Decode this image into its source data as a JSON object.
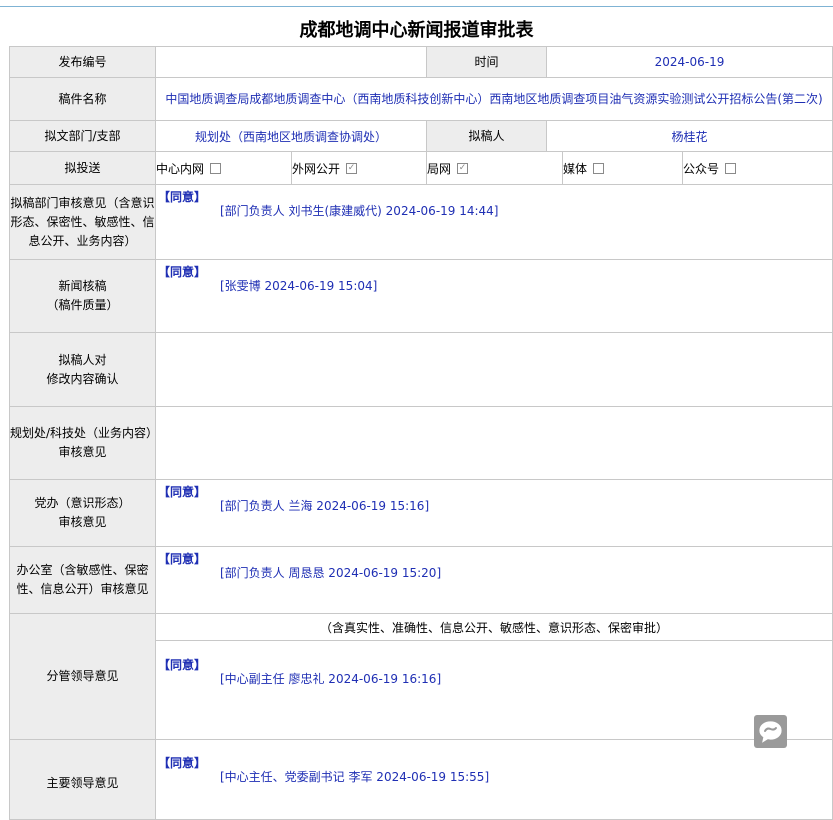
{
  "title": "成都地调中心新闻报道审批表",
  "rows": {
    "publish_no": {
      "label": "发布编号",
      "value": ""
    },
    "time": {
      "label": "时间",
      "value": "2024-06-19"
    },
    "manuscript": {
      "label": "稿件名称",
      "value": "中国地质调查局成都地质调查中心（西南地质科技创新中心）西南地区地质调查项目油气资源实验测试公开招标公告(第二次)"
    },
    "department": {
      "label": "拟文部门/支部",
      "value": "规划处（西南地区地质调查协调处）"
    },
    "author": {
      "label": "拟稿人",
      "value": "杨桂花"
    },
    "send": {
      "label": "拟投送",
      "options": [
        {
          "label": "中心内网",
          "checked": false
        },
        {
          "label": "外网公开",
          "checked": true
        },
        {
          "label": "局网",
          "checked": true
        },
        {
          "label": "媒体",
          "checked": false
        },
        {
          "label": "公众号",
          "checked": false
        }
      ]
    },
    "dept_review": {
      "label": "拟稿部门审核意见（含意识形态、保密性、敏感性、信息公开、业务内容）",
      "agree": "【同意】",
      "sign": "[部门负责人 刘书生(康建威代) 2024-06-19 14:44]"
    },
    "news_review": {
      "label_line1": "新闻核稿",
      "label_line2": "（稿件质量）",
      "agree": "【同意】",
      "sign": "[张雯博 2024-06-19 15:04]"
    },
    "author_confirm": {
      "label_line1": "拟稿人对",
      "label_line2": "修改内容确认"
    },
    "planning_review": {
      "label_line1": "规划处/科技处（业务内容）",
      "label_line2": "审核意见"
    },
    "party_review": {
      "label_line1": "党办（意识形态）",
      "label_line2": "审核意见",
      "agree": "【同意】",
      "sign": "[部门负责人 兰海 2024-06-19 15:16]"
    },
    "office_review": {
      "label": "办公室（含敏感性、保密性、信息公开）审核意见",
      "agree": "【同意】",
      "sign": "[部门负责人 周恳恳 2024-06-19 15:20]"
    },
    "leader_review": {
      "label": "分管领导意见",
      "note": "（含真实性、准确性、信息公开、敏感性、意识形态、保密审批）",
      "agree": "【同意】",
      "sign": "[中心副主任 廖忠礼 2024-06-19 16:16]"
    },
    "main_leader": {
      "label": "主要领导意见",
      "agree": "【同意】",
      "sign": "[中心主任、党委副书记 李军 2024-06-19 15:55]"
    }
  },
  "icons": {
    "chat": "chat-bubble-icon",
    "check": "✓"
  }
}
